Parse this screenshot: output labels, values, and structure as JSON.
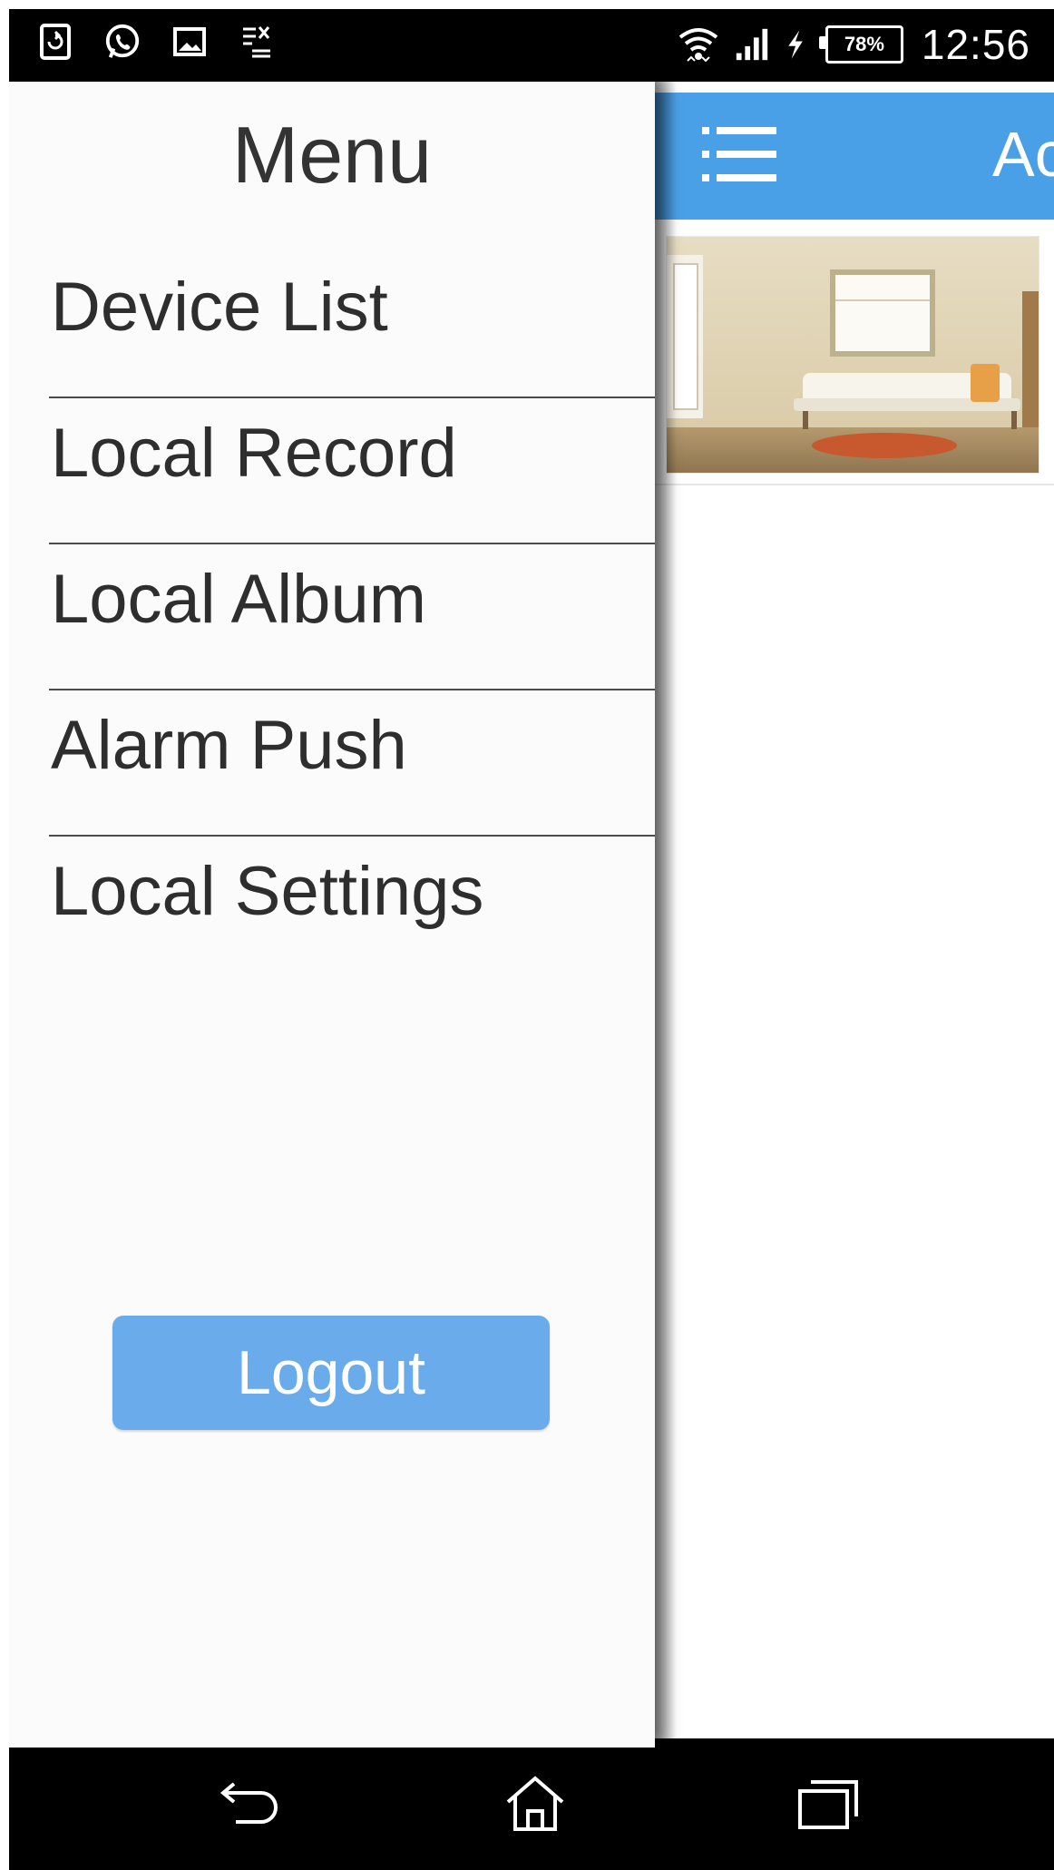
{
  "status_bar": {
    "left_icons": [
      "screenshot-icon",
      "whatsapp-icon",
      "gallery-icon",
      "notes-icon"
    ],
    "right_icons": [
      "wifi-icon",
      "signal-icon",
      "charging-icon"
    ],
    "battery": "78%",
    "time": "12:56"
  },
  "drawer": {
    "title": "Menu",
    "items": [
      {
        "label": "Device List"
      },
      {
        "label": "Local Record"
      },
      {
        "label": "Local Album"
      },
      {
        "label": "Alarm Push"
      },
      {
        "label": "Local Settings"
      }
    ],
    "logout_label": "Logout"
  },
  "main": {
    "title_partial": "Ac",
    "thumbnail": "room-thumbnail"
  },
  "nav_bar": {
    "buttons": [
      "back-icon",
      "home-icon",
      "recents-icon"
    ]
  },
  "colors": {
    "topbar": "#4aa0e7",
    "logout": "#6aaceb",
    "drawer_bg": "#fbfbfb"
  }
}
